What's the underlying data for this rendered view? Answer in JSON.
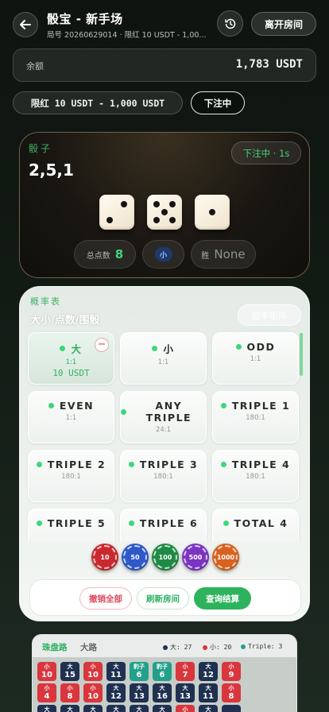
{
  "header": {
    "title": "骰宝 - 新手场",
    "subtitle": "局号 20260629014 · 限红 10 USDT - 1,00...",
    "leave_label": "离开房间"
  },
  "balance": {
    "label": "余额",
    "value": "1,783 USDT"
  },
  "limit_text": "限红 10 USDT - 1,000 USDT",
  "betting_label": "下注中",
  "dice": {
    "label": "骰子",
    "result": "2,5,1",
    "status": "下注中 · 1s",
    "values": [
      2,
      5,
      1
    ],
    "total_label": "总点数",
    "total": "8",
    "size_label": "小",
    "win_label": "胜",
    "win_value": "None"
  },
  "bets": {
    "odds_label": "概率表",
    "title": "大小/点数/围骰",
    "matrix_label": "赔率矩阵",
    "cells": [
      {
        "name": "大",
        "odds": "1:1",
        "amount": "10 USDT"
      },
      {
        "name": "小",
        "odds": "1:1"
      },
      {
        "name": "ODD",
        "odds": "1:1"
      },
      {
        "name": "EVEN",
        "odds": "1:1"
      },
      {
        "name": "ANY TRIPLE",
        "odds": "24:1"
      },
      {
        "name": "TRIPLE 1",
        "odds": "180:1"
      },
      {
        "name": "TRIPLE 2",
        "odds": "180:1"
      },
      {
        "name": "TRIPLE 3",
        "odds": "180:1"
      },
      {
        "name": "TRIPLE 4",
        "odds": "180:1"
      },
      {
        "name": "TRIPLE 5",
        "odds": ""
      },
      {
        "name": "TRIPLE 6",
        "odds": ""
      },
      {
        "name": "TOTAL 4",
        "odds": ""
      }
    ],
    "chips": [
      {
        "label": "10",
        "color": "#c9282e"
      },
      {
        "label": "50",
        "color": "#2f58c9"
      },
      {
        "label": "100",
        "color": "#1f8a45"
      },
      {
        "label": "500",
        "color": "#7a35c2"
      },
      {
        "label": "1000",
        "color": "#d8621f"
      }
    ],
    "actions": {
      "cancel_all": "撤销全部",
      "refresh": "刷新房间",
      "query": "查询结算"
    }
  },
  "road": {
    "tab_bead": "珠盘路",
    "tab_big": "大路",
    "legend": [
      {
        "text": "大: 27",
        "color": "#1f3050"
      },
      {
        "text": "小: 20",
        "color": "#d9363e"
      },
      {
        "text": "Triple: 3",
        "color": "#23a08a"
      }
    ],
    "rows": [
      [
        {
          "t": "小",
          "n": "10",
          "c": "r"
        },
        {
          "t": "大",
          "n": "15",
          "c": "b"
        },
        {
          "t": "小",
          "n": "10",
          "c": "r"
        },
        {
          "t": "大",
          "n": "11",
          "c": "b"
        },
        {
          "t": "豹子",
          "n": "6",
          "c": "g"
        },
        {
          "t": "豹子",
          "n": "6",
          "c": "g"
        },
        {
          "t": "小",
          "n": "7",
          "c": "r"
        },
        {
          "t": "大",
          "n": "12",
          "c": "b"
        },
        {
          "t": "小",
          "n": "9",
          "c": "r"
        }
      ],
      [
        {
          "t": "小",
          "n": "4",
          "c": "r"
        },
        {
          "t": "小",
          "n": "8",
          "c": "r"
        },
        {
          "t": "小",
          "n": "10",
          "c": "r"
        },
        {
          "t": "大",
          "n": "12",
          "c": "b"
        },
        {
          "t": "大",
          "n": "13",
          "c": "b"
        },
        {
          "t": "大",
          "n": "16",
          "c": "b"
        },
        {
          "t": "大",
          "n": "13",
          "c": "b"
        },
        {
          "t": "大",
          "n": "11",
          "c": "b"
        },
        {
          "t": "小",
          "n": "8",
          "c": "r"
        }
      ],
      [
        {
          "t": "大",
          "n": "",
          "c": "b"
        },
        {
          "t": "大",
          "n": "",
          "c": "b"
        },
        {
          "t": "大",
          "n": "",
          "c": "b"
        },
        {
          "t": "大",
          "n": "",
          "c": "b"
        },
        {
          "t": "大",
          "n": "",
          "c": "b"
        },
        {
          "t": "大",
          "n": "",
          "c": "b"
        },
        {
          "t": "小",
          "n": "",
          "c": "r"
        },
        {
          "t": "大",
          "n": "",
          "c": "b"
        },
        {
          "t": "",
          "n": "",
          "c": "b"
        }
      ]
    ]
  }
}
